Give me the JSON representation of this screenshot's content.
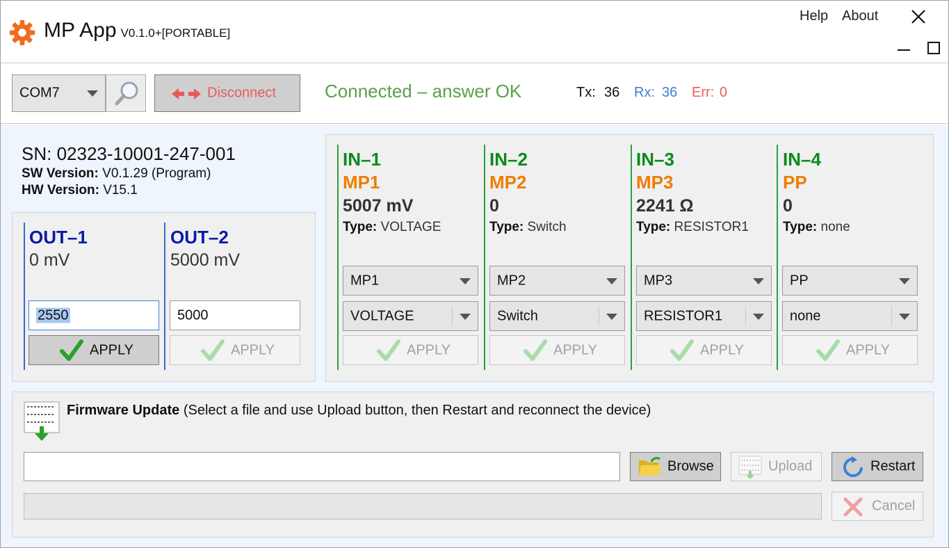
{
  "titlebar": {
    "app_name": "MP App",
    "version": "V0.1.0+[PORTABLE]",
    "menu": {
      "help": "Help",
      "about": "About"
    }
  },
  "toolbar": {
    "port": "COM7",
    "disconnect_label": "Disconnect",
    "status": "Connected – answer OK",
    "tx_label": "Tx:",
    "tx_value": "36",
    "rx_label": "Rx:",
    "rx_value": "36",
    "err_label": "Err:",
    "err_value": "0"
  },
  "device": {
    "sn": "SN: 02323-10001-247-001",
    "sw_label": "SW Version:",
    "sw_value": "V0.1.29 (Program)",
    "hw_label": "HW Version:",
    "hw_value": "V15.1"
  },
  "outputs": [
    {
      "title": "OUT–1",
      "value": "0 mV",
      "input": "2550",
      "apply": "APPLY",
      "apply_enabled": true
    },
    {
      "title": "OUT–2",
      "value": "5000 mV",
      "input": "5000",
      "apply": "APPLY",
      "apply_enabled": false
    }
  ],
  "inputs": [
    {
      "title": "IN–1",
      "mode": "MP1",
      "value": "5007 mV",
      "type_label": "Type:",
      "type_value": "VOLTAGE",
      "select_mode": "MP1",
      "select_type": "VOLTAGE",
      "apply": "APPLY"
    },
    {
      "title": "IN–2",
      "mode": "MP2",
      "value": "0",
      "type_label": "Type:",
      "type_value": "Switch",
      "select_mode": "MP2",
      "select_type": "Switch",
      "apply": "APPLY"
    },
    {
      "title": "IN–3",
      "mode": "MP3",
      "value": "2241 Ω",
      "type_label": "Type:",
      "type_value": "RESISTOR1",
      "select_mode": "MP3",
      "select_type": "RESISTOR1",
      "apply": "APPLY"
    },
    {
      "title": "IN–4",
      "mode": "PP",
      "value": "0",
      "type_label": "Type:",
      "type_value": "none",
      "select_mode": "PP",
      "select_type": "none",
      "apply": "APPLY"
    }
  ],
  "firmware": {
    "title": "Firmware Update",
    "hint": "(Select a file and use Upload button, then Restart and reconnect the device)",
    "file_path": "",
    "browse": "Browse",
    "upload": "Upload",
    "restart": "Restart",
    "cancel": "Cancel",
    "progress": 0
  },
  "colors": {
    "green": "#0a8a1a",
    "orange": "#f07d00",
    "blue": "#0a1aa8",
    "status_green": "#5aa04a",
    "rx_blue": "#3b7fd6",
    "err_red": "#ee5a5a",
    "disconnect_red": "#e85a5a"
  }
}
